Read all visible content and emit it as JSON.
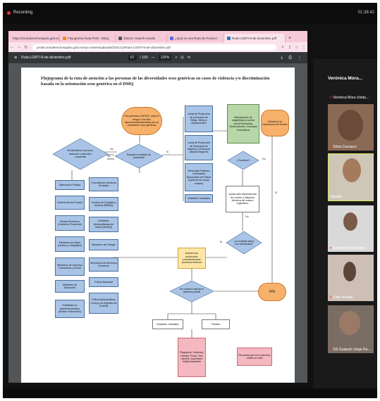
{
  "recording": {
    "label": "Recording"
  },
  "clock": "01:38:42",
  "browser": {
    "tabs": [
      {
        "label": "https://mail.derechosquito.gob.ec"
      },
      {
        "label": "Flujograma Ruta PAM - Dibuj"
      },
      {
        "label": "Zintros: Search results"
      },
      {
        "label": "¿Qué es una Ruta de Protecci"
      },
      {
        "label": "Ruta-LGBTI-8-de-diciembre.pdf",
        "active": true
      }
    ],
    "new_tab": "+",
    "url": "proteccionderechosquito.gob.ec/wp-content/uploads/2021/12/Ruta-LGBTI-8-de-diciembre.pdf"
  },
  "pdf": {
    "filename": "Ruta-LGBTI-8-de-diciembre.pdf",
    "page_current": "67",
    "page_total": "/ 100",
    "zoom": "125%",
    "title": "Flujograma de la ruta de atención a las personas de las diversidades sexo genéricas en casos de violencia y/o discriminación basada en la orientación sexo genérica en el DMQ"
  },
  "flow": {
    "start": "Una persona LGBTIQ+ está en riesgo o ha sido discriminada/violentada por su orientación sexo genérica",
    "q1": "Se identifica el servicio, asesoría o atención requerida",
    "q1_no": "No",
    "q2": "Requiere medidas de protección",
    "q2_no": "No",
    "q2_side": "Se deriva",
    "q2_si": "Si",
    "juntas": [
      "Junta de Protección de Derechos de Niñas, Niños y Adolescentes",
      "Junta de Protección de Derechos de Mujeres y Personas Adultas Mayores",
      "Tenencias Políticas, Comisarías Nacionales de Policía (rupturas en zonas rurales)",
      "Unidades Judiciales"
    ],
    "mecanismos": "Mecanismos de exigibilidad y control social Veedurías, Observatorios, Consejos Consultivos",
    "solicitud": "Solicitud a la Defensoría del Pueblo",
    "funciono": "¿Funcionó?",
    "no1": "No",
    "si1": "Si",
    "queja": "Queja ante dependencia de control o instancia directiva del mismo organismo",
    "entidad": "¿La entidad actuó con efectividad?",
    "si2": "Si",
    "no2": "No",
    "activan": "Activan sus protocolos/ procedimientos/ procesos internos",
    "services_left": [
      "Defensoría Pública",
      "Defensoría del Pueblo",
      "Mesas Pichincha (Gobierno Provincial)",
      "Ministerio de Salud (centros y hospitales)",
      "Ministerio de Inclusión Económica y Social",
      "Ministerio de Educación",
      "Entidades no gubernamentales (revisar el directorio)"
    ],
    "services_right": [
      "Consultorios Jurídicos Gratuitos",
      "Centros de Equidad y Justicia (MDMQ)",
      "Unidades Metropolitanas de Salud (MDMQ)",
      "Ministerio de Trabajo",
      "Secretaría de Derechos Humanos",
      "Policía Nacional",
      "Policía Metropolitana (Cuerpo de Agentes de Control)"
    ],
    "judicial": "Se requiere activar el sistema judicial",
    "unidades": "Unidades Judiciales",
    "fiscalia": "Fiscalía",
    "fin": "FIN",
    "flagrancia": "Flagrancia, Violencia, Familia, Penal, Civil, Laboral, Inquilinato, Multicompetente",
    "recuerda": "Recuerda que es tu derecho recibir un trato"
  },
  "participants": {
    "host": "Verónica Mora...",
    "list": [
      {
        "name": "Verónica Mora Unida..."
      },
      {
        "name": "Silvia Carrasco"
      },
      {
        "name": "Damián"
      },
      {
        "name": "Edwardo Maldonado ..."
      },
      {
        "name": "Carly Acosta"
      },
      {
        "name": "GS Guapulo Jorge Ra..."
      }
    ]
  },
  "colors": {
    "tab_strip": "#f6c9d8",
    "pdf_toolbar": "#323639",
    "flow_blue": "#a9c4e6",
    "flow_orange": "#f7b16b",
    "flow_green": "#b7d7a8",
    "flow_yellow": "#fde6a6"
  }
}
